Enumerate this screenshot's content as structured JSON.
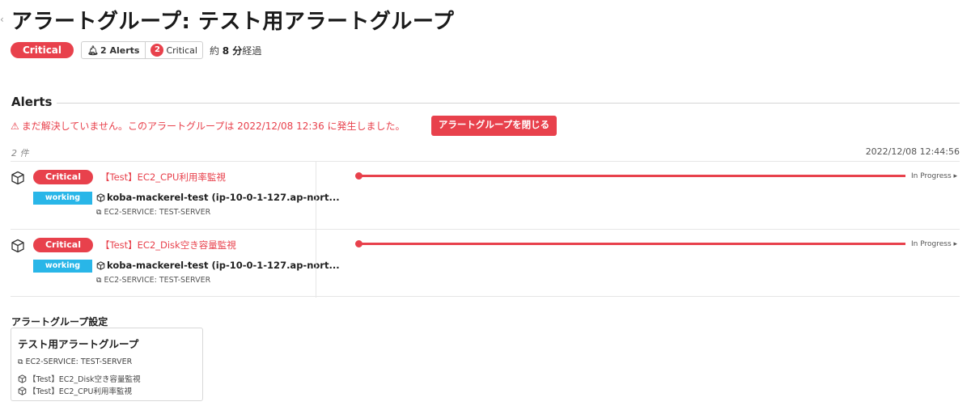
{
  "header": {
    "title": "アラートグループ: テスト用アラートグループ",
    "back_icon": "chevron-left-icon"
  },
  "status": {
    "severity": "Critical",
    "alerts_count": "2 Alerts",
    "critical_count": "2",
    "critical_label": "Critical",
    "elapsed_prefix": "約",
    "elapsed_value": "8 分",
    "elapsed_suffix": "経過"
  },
  "alerts_section": {
    "heading": "Alerts",
    "warning": "まだ解決していません。このアラートグループは 2022/12/08 12:36 に発生しました。",
    "close_button": "アラートグループを閉じる",
    "item_count": "2 件",
    "timestamp": "2022/12/08 12:44:56",
    "rows": [
      {
        "severity": "Critical",
        "monitor": "【Test】EC2_CPU利用率監視",
        "status": "working",
        "host": "koba-mackerel-test (ip-10-0-1-127.ap-nort...",
        "service": "EC2-SERVICE: TEST-SERVER",
        "progress": "In Progress ▸"
      },
      {
        "severity": "Critical",
        "monitor": "【Test】EC2_Disk空き容量監視",
        "status": "working",
        "host": "koba-mackerel-test (ip-10-0-1-127.ap-nort...",
        "service": "EC2-SERVICE: TEST-SERVER",
        "progress": "In Progress ▸"
      }
    ]
  },
  "settings": {
    "heading": "アラートグループ設定",
    "card_title": "テスト用アラートグループ",
    "service": "EC2-SERVICE: TEST-SERVER",
    "monitors": [
      "【Test】EC2_Disk空き容量監視",
      "【Test】EC2_CPU利用率監視"
    ]
  },
  "colors": {
    "critical": "#e8414c",
    "working": "#29b6e8"
  }
}
